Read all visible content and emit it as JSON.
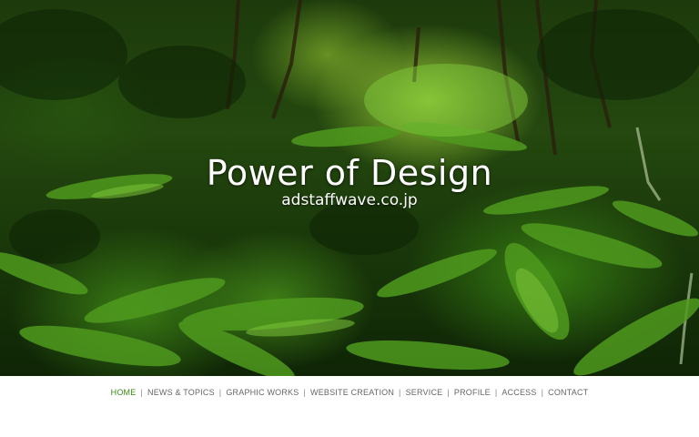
{
  "hero": {
    "title": "Power of Design",
    "subtitle": "adstaffwave.co.jp",
    "background_image": "jungle-ferns-photo"
  },
  "nav": {
    "items": [
      {
        "label": "HOME",
        "active": true
      },
      {
        "label": "NEWS & TOPICS",
        "active": false
      },
      {
        "label": "GRAPHIC WORKS",
        "active": false
      },
      {
        "label": "WEBSITE CREATION",
        "active": false
      },
      {
        "label": "SERVICE",
        "active": false
      },
      {
        "label": "PROFILE",
        "active": false
      },
      {
        "label": "ACCESS",
        "active": false
      },
      {
        "label": "CONTACT",
        "active": false
      }
    ],
    "separator": "|",
    "active_color": "#3a8a14",
    "text_color": "#666666"
  }
}
